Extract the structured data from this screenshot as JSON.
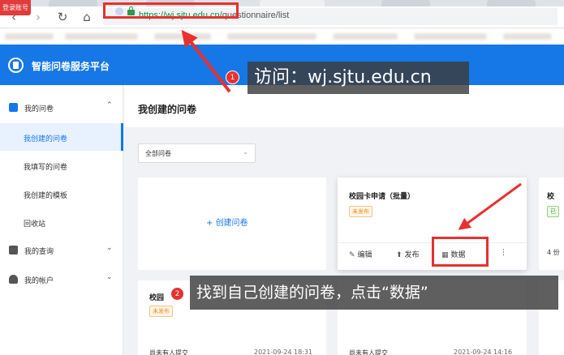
{
  "browser": {
    "login_badge": "登录账号",
    "url_host": "https://wj.sjtu.edu.cn/",
    "url_path": "questionnaire/list"
  },
  "header": {
    "brand": "智能问卷服务平台"
  },
  "sidebar": {
    "groups": [
      {
        "label": "我的问卷",
        "expanded": true
      },
      {
        "label": "我的查询"
      },
      {
        "label": "我的帐户"
      }
    ],
    "items": [
      {
        "label": "我创建的问卷",
        "active": true
      },
      {
        "label": "我填写的问卷"
      },
      {
        "label": "我创建的模板"
      },
      {
        "label": "回收站"
      }
    ]
  },
  "main": {
    "title": "我创建的问卷",
    "filter": {
      "value": "全部问卷"
    },
    "create_label": "创建问卷",
    "cards": [
      {
        "title": "校园卡申请（批量）",
        "status": "未发布",
        "actions": {
          "edit": "编辑",
          "publish": "发布",
          "data": "数据"
        }
      },
      {
        "title": "校",
        "status": "已",
        "footer": "4 份"
      },
      {
        "title": "校园",
        "status": "未发布",
        "footer": "尚未有人提交",
        "date": "2021-09-24 18:31"
      },
      {
        "title": "",
        "footer": "尚未有人提交",
        "date": "2021-09-24 14:16"
      }
    ]
  },
  "annotations": {
    "step1_number": "1",
    "step1_text": "访问：wj.sjtu.edu.cn",
    "step2_number": "2",
    "step2_text": "找到自己创建的问卷，点击“数据”"
  },
  "colors": {
    "primary": "#1677e6",
    "highlight_red": "#e8302f",
    "status_orange": "#e8911a",
    "https_green": "#0b8f43"
  }
}
